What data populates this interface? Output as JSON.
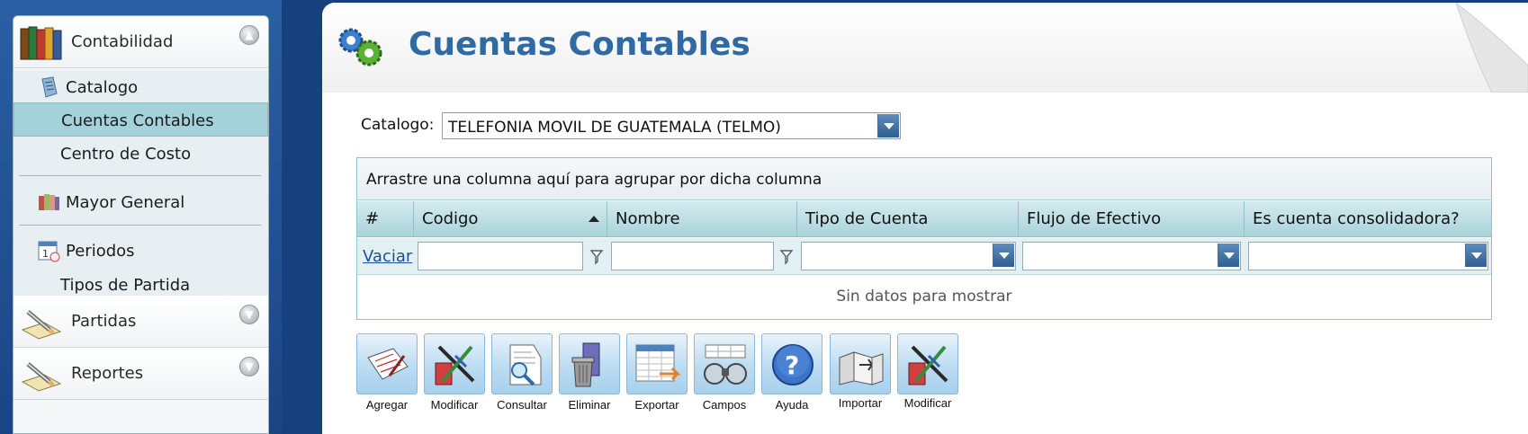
{
  "sidebar": {
    "groups": [
      {
        "label": "Contabilidad",
        "icon": "books-icon",
        "expanded": true
      },
      {
        "label": "Partidas",
        "icon": "pencil-paper-icon",
        "expanded": false
      },
      {
        "label": "Reportes",
        "icon": "pencil-paper-icon",
        "expanded": false
      }
    ],
    "items": [
      {
        "label": "Catalogo",
        "icon": "catalog-icon"
      },
      {
        "label": "Cuentas Contables",
        "selected": true
      },
      {
        "label": "Centro de Costo"
      },
      {
        "label": "Mayor General",
        "icon": "ledger-icon"
      },
      {
        "label": "Periodos",
        "icon": "calendar-icon"
      },
      {
        "label": "Tipos de Partida"
      }
    ]
  },
  "header": {
    "title": "Cuentas Contables",
    "icon": "gears-icon"
  },
  "catalog": {
    "label": "Catalogo:",
    "selected_value": "TELEFONIA MOVIL DE GUATEMALA (TELMO)"
  },
  "grid": {
    "group_hint": "Arrastre una columna aquí para agrupar por dicha columna",
    "columns": [
      "#",
      "Codigo",
      "Nombre",
      "Tipo de Cuenta",
      "Flujo de Efectivo",
      "Es cuenta consolidadora?"
    ],
    "sorted_column": "Codigo",
    "sort_direction": "ascending",
    "clear_filter_link": "Vaciar",
    "empty_message": "Sin datos para mostrar"
  },
  "toolbar": {
    "buttons": [
      {
        "label": "Agregar",
        "icon": "add-document-icon"
      },
      {
        "label": "Modificar",
        "icon": "edit-tools-icon"
      },
      {
        "label": "Consultar",
        "icon": "magnifier-document-icon"
      },
      {
        "label": "Eliminar",
        "icon": "trash-icon"
      },
      {
        "label": "Exportar",
        "icon": "spreadsheet-export-icon"
      },
      {
        "label": "Campos",
        "icon": "binoculars-icon"
      },
      {
        "label": "Ayuda",
        "icon": "help-icon"
      },
      {
        "label": "Importar",
        "icon": "import-icon"
      },
      {
        "label": "Modificar",
        "icon": "edit-tools-icon"
      }
    ]
  },
  "colors": {
    "title": "#2f6aa5",
    "selected_item": "#a3d2da",
    "grid_header": "#a9d3da",
    "background": "#16407e"
  }
}
